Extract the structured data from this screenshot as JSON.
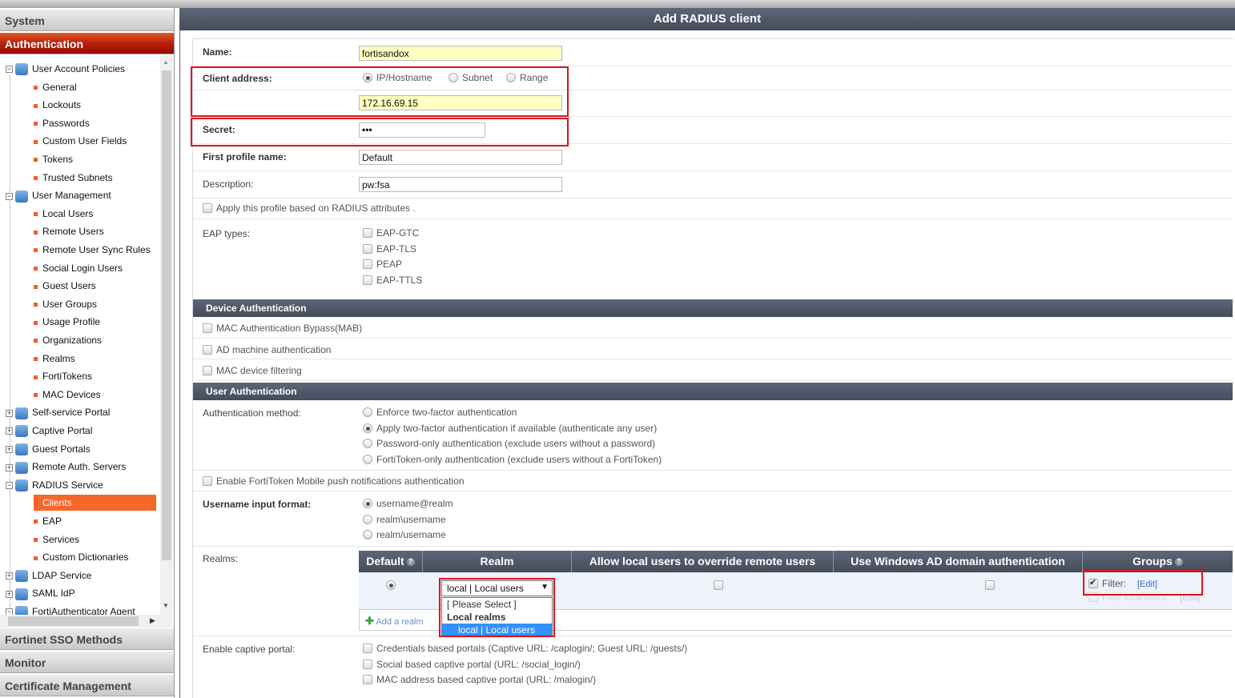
{
  "sidebar": {
    "sections": {
      "system": "System",
      "authentication": "Authentication",
      "sso": "Fortinet SSO Methods",
      "monitor": "Monitor",
      "certs": "Certificate Management"
    },
    "tree": [
      {
        "label": "User Account Policies",
        "level": 0,
        "expand": "-"
      },
      {
        "label": "General",
        "level": 1
      },
      {
        "label": "Lockouts",
        "level": 1
      },
      {
        "label": "Passwords",
        "level": 1
      },
      {
        "label": "Custom User Fields",
        "level": 1
      },
      {
        "label": "Tokens",
        "level": 1
      },
      {
        "label": "Trusted Subnets",
        "level": 1
      },
      {
        "label": "User Management",
        "level": 0,
        "expand": "-"
      },
      {
        "label": "Local Users",
        "level": 1
      },
      {
        "label": "Remote Users",
        "level": 1
      },
      {
        "label": "Remote User Sync Rules",
        "level": 1
      },
      {
        "label": "Social Login Users",
        "level": 1
      },
      {
        "label": "Guest Users",
        "level": 1
      },
      {
        "label": "User Groups",
        "level": 1
      },
      {
        "label": "Usage Profile",
        "level": 1
      },
      {
        "label": "Organizations",
        "level": 1
      },
      {
        "label": "Realms",
        "level": 1
      },
      {
        "label": "FortiTokens",
        "level": 1
      },
      {
        "label": "MAC Devices",
        "level": 1
      },
      {
        "label": "Self-service Portal",
        "level": 0,
        "expand": "+"
      },
      {
        "label": "Captive Portal",
        "level": 0,
        "expand": "+"
      },
      {
        "label": "Guest Portals",
        "level": 0,
        "expand": "+"
      },
      {
        "label": "Remote Auth. Servers",
        "level": 0,
        "expand": "+"
      },
      {
        "label": "RADIUS Service",
        "level": 0,
        "expand": "-"
      },
      {
        "label": "Clients",
        "level": 1,
        "selected": true
      },
      {
        "label": "EAP",
        "level": 1
      },
      {
        "label": "Services",
        "level": 1
      },
      {
        "label": "Custom Dictionaries",
        "level": 1
      },
      {
        "label": "LDAP Service",
        "level": 0,
        "expand": "+"
      },
      {
        "label": "SAML IdP",
        "level": 0,
        "expand": "+"
      },
      {
        "label": "FortiAuthenticator Agent",
        "level": 0,
        "expand": "-"
      }
    ]
  },
  "main": {
    "title": "Add RADIUS client",
    "name_label": "Name:",
    "name_value": "fortisandox",
    "client_address_label": "Client address:",
    "client_address_options": [
      {
        "label": "IP/Hostname",
        "checked": true
      },
      {
        "label": "Subnet",
        "checked": false
      },
      {
        "label": "Range",
        "checked": false
      }
    ],
    "client_address_value": "172.16.69.15",
    "secret_label": "Secret:",
    "secret_value": "•••",
    "profile_label": "First profile name:",
    "profile_value": "Default",
    "description_label": "Description:",
    "description_value": "pw:fsa",
    "apply_profile_label": "Apply this profile based on RADIUS attributes .",
    "eap_label": "EAP types:",
    "eap_types": [
      "EAP-GTC",
      "EAP-TLS",
      "PEAP",
      "EAP-TTLS"
    ],
    "device_auth_title": "Device Authentication",
    "device_auth_options": [
      "MAC Authentication Bypass(MAB)",
      "AD machine authentication",
      "MAC device filtering"
    ],
    "user_auth_title": "User Authentication",
    "auth_method_label": "Authentication method:",
    "auth_methods": [
      {
        "label": "Enforce two-factor authentication",
        "checked": false
      },
      {
        "label": "Apply two-factor authentication if available (authenticate any user)",
        "checked": true
      },
      {
        "label": "Password-only authentication (exclude users without a password)",
        "checked": false
      },
      {
        "label": "FortiToken-only authentication (exclude users without a FortiToken)",
        "checked": false
      }
    ],
    "push_label": "Enable FortiToken Mobile push notifications authentication",
    "username_format_label": "Username input format:",
    "username_formats": [
      {
        "label": "username@realm",
        "checked": true
      },
      {
        "label": "realm\\username",
        "checked": false
      },
      {
        "label": "realm/username",
        "checked": false
      }
    ],
    "realms_label": "Realms:",
    "realms_table": {
      "headers": [
        "Default",
        "Realm",
        "Allow local users to override remote users",
        "Use Windows AD domain authentication",
        "Groups"
      ],
      "selected_realm": "local | Local users",
      "dropdown_options": [
        "[ Please Select ]",
        "Local realms",
        "local | Local users"
      ],
      "filter_label": "Filter:",
      "edit_label": "[Edit]",
      "filter_local_label": "Filter local users:",
      "edit_local_label": "[Edit]",
      "add_realm": "Add a realm"
    },
    "captive_label": "Enable captive portal:",
    "captive_options": [
      "Credentials based portals (Captive URL: /caplogin/; Guest URL: /guests/)",
      "Social based captive portal (URL: /social_login/)",
      "MAC address based captive portal (URL: /malogin/)"
    ]
  },
  "colors": {
    "accent": "#f5682a",
    "header": "#4f5768",
    "highlight": "#e01020"
  }
}
